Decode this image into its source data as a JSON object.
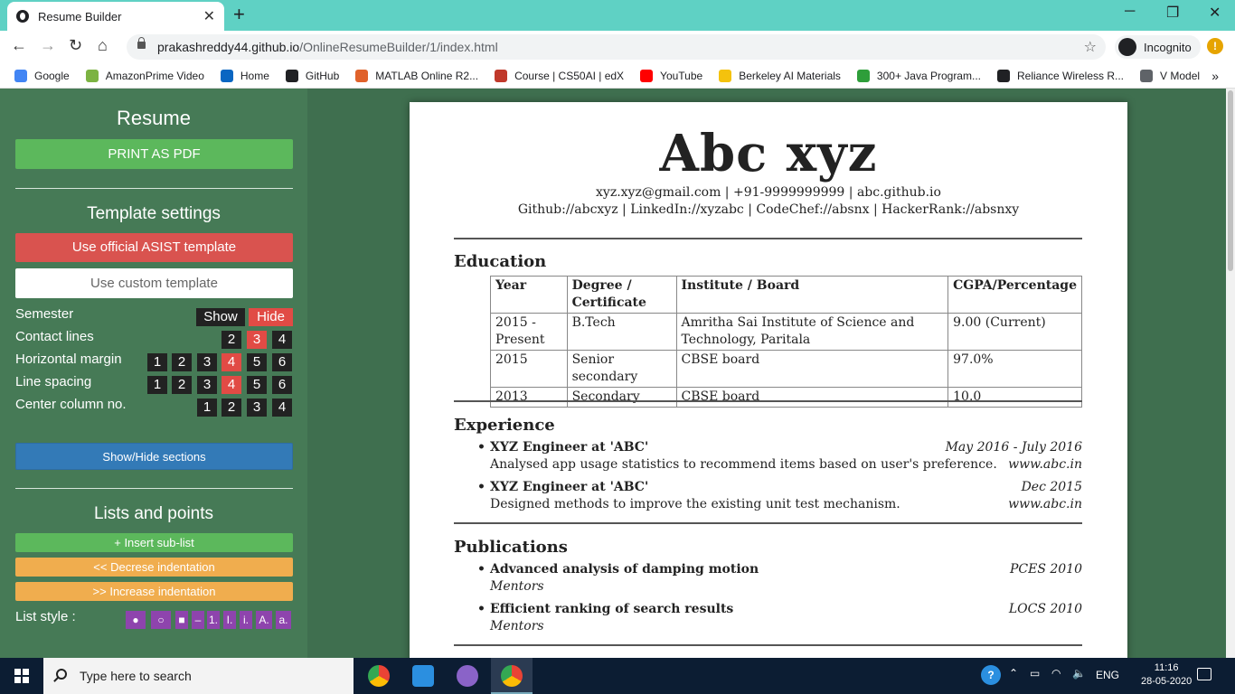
{
  "browser": {
    "tab_title": "Resume Builder",
    "url_host": "prakashreddy44.github.io",
    "url_path": "/OnlineResumeBuilder/1/index.html",
    "incognito_label": "Incognito",
    "bookmarks": [
      {
        "label": "Google",
        "color": "#4285f4"
      },
      {
        "label": "AmazonPrime Video",
        "color": "#7cb342"
      },
      {
        "label": "Home",
        "color": "#0a66c2"
      },
      {
        "label": "GitHub",
        "color": "#202124"
      },
      {
        "label": "MATLAB Online R2...",
        "color": "#e0622b"
      },
      {
        "label": "Course | CS50AI | edX",
        "color": "#c0392b"
      },
      {
        "label": "YouTube",
        "color": "#ff0000"
      },
      {
        "label": "Berkeley AI Materials",
        "color": "#f4c20d"
      },
      {
        "label": "300+ Java Program...",
        "color": "#2e9e3a"
      },
      {
        "label": "Reliance Wireless R...",
        "color": "#202124"
      },
      {
        "label": "V Model",
        "color": "#5f6368"
      }
    ]
  },
  "sidebar": {
    "title": "Resume",
    "print_label": "PRINT AS PDF",
    "template_title": "Template settings",
    "official_template_label": "Use official ASIST template",
    "custom_template_label": "Use custom template",
    "options": {
      "semester": {
        "label": "Semester",
        "choices": [
          "Show",
          "Hide"
        ],
        "selected": "Hide"
      },
      "contact_lines": {
        "label": "Contact lines",
        "choices": [
          "2",
          "3",
          "4"
        ],
        "selected": "3"
      },
      "horizontal_margin": {
        "label": "Horizontal margin",
        "choices": [
          "1",
          "2",
          "3",
          "4",
          "5",
          "6"
        ],
        "selected": "4"
      },
      "line_spacing": {
        "label": "Line spacing",
        "choices": [
          "1",
          "2",
          "3",
          "4",
          "5",
          "6"
        ],
        "selected": "4"
      },
      "center_column": {
        "label": "Center column no.",
        "choices": [
          "1",
          "2",
          "3",
          "4"
        ],
        "selected": ""
      }
    },
    "sections_label": "Show/Hide sections",
    "lists_title": "Lists and points",
    "insert_sublist": "+ Insert sub-list",
    "decrease_indent": "<< Decrese indentation",
    "increase_indent": ">> Increase indentation",
    "list_style_label": "List style :",
    "list_styles": [
      "●",
      "○",
      "■",
      "–",
      "1.",
      "I.",
      "i.",
      "A.",
      "a."
    ]
  },
  "resume": {
    "name": "Abc xyz",
    "contact_line1": "xyz.xyz@gmail.com | +91-9999999999 | abc.github.io",
    "contact_line2": "Github://abcxyz | LinkedIn://xyzabc | CodeChef://absnx | HackerRank://absnxy",
    "education": {
      "title": "Education",
      "headers": [
        "Year",
        "Degree / Certificate",
        "Institute / Board",
        "CGPA/Percentage"
      ],
      "rows": [
        [
          "2015 - Present",
          "B.Tech",
          "Amritha Sai Institute of Science and Technology, Paritala",
          "9.00 (Current)"
        ],
        [
          "2015",
          "Senior secondary",
          "CBSE board",
          "97.0%"
        ],
        [
          "2013",
          "Secondary",
          "CBSE board",
          "10.0"
        ]
      ]
    },
    "experience": {
      "title": "Experience",
      "items": [
        {
          "role": "XYZ Engineer at 'ABC'",
          "date": "May 2016 - July 2016",
          "desc": "Analysed app usage statistics to recommend items based on user's preference.",
          "link": "www.abc.in"
        },
        {
          "role": "XYZ Engineer at 'ABC'",
          "date": "Dec 2015",
          "desc": "Designed methods to improve the existing unit test mechanism.",
          "link": "www.abc.in"
        }
      ]
    },
    "publications": {
      "title": "Publications",
      "items": [
        {
          "title": "Advanced analysis of damping motion",
          "venue": "PCES 2010",
          "sub": "Mentors"
        },
        {
          "title": "Efficient ranking of search results",
          "venue": "LOCS 2010",
          "sub": "Mentors"
        }
      ]
    }
  },
  "taskbar": {
    "search_placeholder": "Type here to search",
    "lang": "ENG",
    "time": "11:16",
    "date": "28-05-2020"
  }
}
